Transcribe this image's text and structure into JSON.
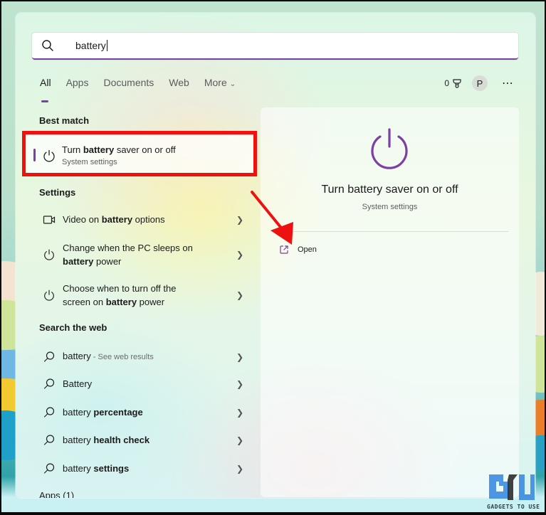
{
  "search": {
    "value": "battery",
    "icon": "search-icon"
  },
  "tabs": [
    {
      "label": "All",
      "active": true
    },
    {
      "label": "Apps"
    },
    {
      "label": "Documents"
    },
    {
      "label": "Web"
    },
    {
      "label": "More"
    }
  ],
  "header_right": {
    "points": "0",
    "points_icon": "rewards-trophy-icon",
    "avatar_initial": "P",
    "more_icon": "ellipsis-icon"
  },
  "sections": {
    "best_match": "Best match",
    "settings": "Settings",
    "search_web": "Search the web",
    "apps": "Apps (1)"
  },
  "best_match": {
    "title_pre": "Turn ",
    "title_bold": "battery",
    "title_post": " saver on or off",
    "subtitle": "System settings",
    "icon": "power-icon"
  },
  "settings_items": [
    {
      "pre": "Video on ",
      "bold": "battery",
      "post": " options",
      "icon": "video-icon"
    },
    {
      "line1": "Change when the PC sleeps on",
      "bold": "battery",
      "post": " power",
      "icon": "power-icon"
    },
    {
      "line1": "Choose when to turn off the",
      "pre2": "screen on ",
      "bold": "battery",
      "post": " power",
      "icon": "power-icon"
    }
  ],
  "web_items": [
    {
      "pre": "battery",
      "muted": " - See web results",
      "bold": ""
    },
    {
      "pre": "Battery",
      "bold": ""
    },
    {
      "pre": "battery ",
      "bold": "percentage"
    },
    {
      "pre": "battery ",
      "bold": "health check"
    },
    {
      "pre": "battery ",
      "bold": "settings"
    }
  ],
  "detail": {
    "title": "Turn battery saver on or off",
    "subtitle": "System settings",
    "open_label": "Open",
    "accent_color": "#7b3fa5"
  },
  "annotation": {
    "highlight_color": "#f01010"
  },
  "watermark": {
    "text": "GADGETS TO USE"
  }
}
